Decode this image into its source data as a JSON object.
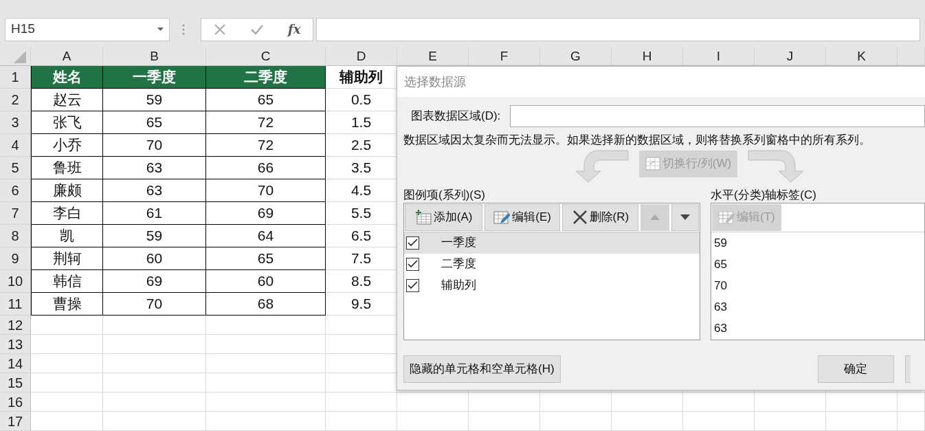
{
  "name_box": {
    "value": "H15"
  },
  "formula_bar": {
    "function_label": "fx"
  },
  "sheet": {
    "columns": [
      {
        "label": "A",
        "bordered": true
      },
      {
        "label": "B",
        "bordered": true
      },
      {
        "label": "C",
        "bordered": true
      },
      {
        "label": "D",
        "bordered": false
      },
      {
        "label": "E",
        "bordered": false
      },
      {
        "label": "F",
        "bordered": false
      },
      {
        "label": "G",
        "bordered": false
      },
      {
        "label": "H",
        "bordered": false
      },
      {
        "label": "I",
        "bordered": false
      },
      {
        "label": "J",
        "bordered": false
      },
      {
        "label": "K",
        "bordered": false
      }
    ],
    "rows": [
      {
        "number": "1",
        "kind": "header",
        "cells": [
          {
            "text": "姓名",
            "color": "#217346"
          },
          {
            "text": "一季度",
            "color": "#217346"
          },
          {
            "text": "二季度",
            "color": "#217346"
          },
          {
            "text": "辅助列"
          }
        ]
      },
      {
        "number": "2",
        "kind": "data",
        "cells": [
          "赵云",
          "59",
          "65",
          "0.5"
        ]
      },
      {
        "number": "3",
        "kind": "data",
        "cells": [
          "张飞",
          "65",
          "72",
          "1.5"
        ]
      },
      {
        "number": "4",
        "kind": "data",
        "cells": [
          "小乔",
          "70",
          "72",
          "2.5"
        ]
      },
      {
        "number": "5",
        "kind": "data",
        "cells": [
          "鲁班",
          "63",
          "66",
          "3.5"
        ]
      },
      {
        "number": "6",
        "kind": "data",
        "cells": [
          "廉颇",
          "63",
          "70",
          "4.5"
        ]
      },
      {
        "number": "7",
        "kind": "data",
        "cells": [
          "李白",
          "61",
          "69",
          "5.5"
        ]
      },
      {
        "number": "8",
        "kind": "data",
        "cells": [
          "凯",
          "59",
          "64",
          "6.5"
        ]
      },
      {
        "number": "9",
        "kind": "data",
        "cells": [
          "荆轲",
          "60",
          "65",
          "7.5"
        ]
      },
      {
        "number": "10",
        "kind": "data",
        "cells": [
          "韩信",
          "69",
          "60",
          "8.5"
        ]
      },
      {
        "number": "11",
        "kind": "data",
        "cells": [
          "曹操",
          "70",
          "68",
          "9.5"
        ]
      },
      {
        "number": "12",
        "kind": "empty"
      },
      {
        "number": "13",
        "kind": "empty"
      },
      {
        "number": "14",
        "kind": "empty"
      },
      {
        "number": "15",
        "kind": "empty"
      },
      {
        "number": "16",
        "kind": "empty"
      },
      {
        "number": "17",
        "kind": "empty"
      }
    ]
  },
  "dialog": {
    "title": "选择数据源",
    "range_label": "图表数据区域(D):",
    "message": "数据区域因太复杂而无法显示。如果选择新的数据区域，则将替换系列窗格中的所有系列。",
    "switch_button": {
      "label": "切换行/列(W)",
      "disabled": true
    },
    "series_pane": {
      "label": "图例项(系列)(S)",
      "toolbar": [
        {
          "kind": "add",
          "label": "添加(A)",
          "disabled": false
        },
        {
          "kind": "edit",
          "label": "编辑(E)",
          "disabled": false
        },
        {
          "kind": "delete",
          "label": "删除(R)",
          "disabled": false
        },
        {
          "kind": "up",
          "disabled": true
        },
        {
          "kind": "down",
          "disabled": false
        }
      ],
      "items": [
        {
          "label": "一季度",
          "checked": true,
          "selected": true
        },
        {
          "label": "二季度",
          "checked": true,
          "selected": false
        },
        {
          "label": "辅助列",
          "checked": true,
          "selected": false
        }
      ]
    },
    "category_pane": {
      "label": "水平(分类)轴标签(C)",
      "edit_button": {
        "label": "编辑(T)",
        "disabled": true
      },
      "items": [
        "59",
        "65",
        "70",
        "63",
        "63"
      ]
    },
    "hidden_cells_button": {
      "label": "隐藏的单元格和空单元格(H)"
    },
    "ok_button": {
      "label": "确定"
    }
  }
}
